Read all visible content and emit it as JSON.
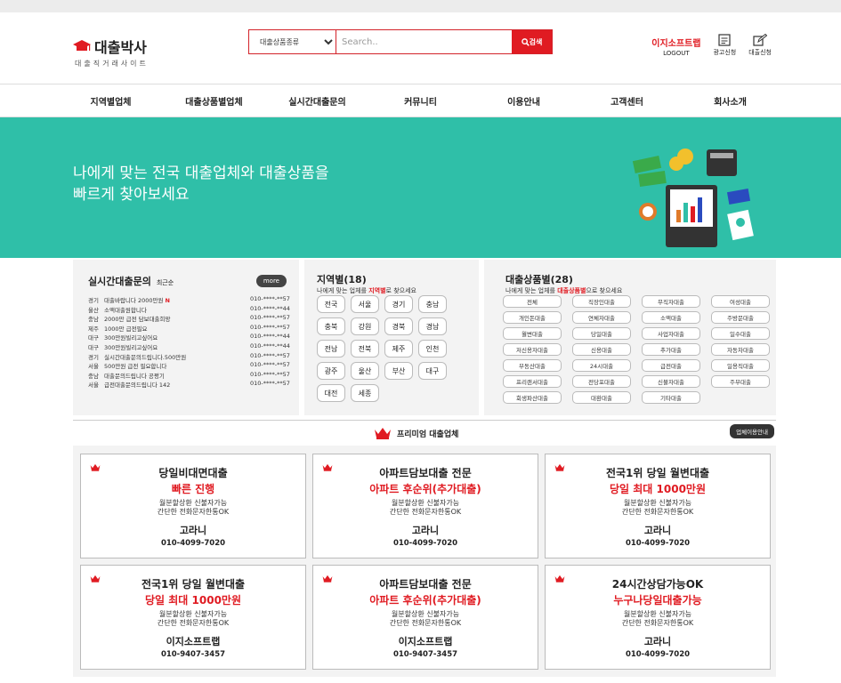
{
  "header": {
    "logo_title": "대출박사",
    "logo_sub": "대출직거래사이트",
    "search_category": "대출상품종류",
    "search_placeholder": "Search..",
    "search_button": "검색",
    "brand_link": "이지소프트랩",
    "logout": "LOGOUT",
    "ad_apply": "광고신청",
    "loan_apply": "대출신청"
  },
  "nav": [
    "지역별업체",
    "대출상품별업체",
    "실시간대출문의",
    "커뮤니티",
    "이용안내",
    "고객센터",
    "회사소개"
  ],
  "banner": {
    "line1": "나에게 맞는 전국 대출업체와 대출상품을",
    "line2": "빠르게 찾아보세요"
  },
  "realtime": {
    "title": "실시간대출문의",
    "sort": "최근순",
    "more": "more",
    "rows": [
      {
        "region": "경기",
        "text": "대출바랍니다 2000만원",
        "new": "N",
        "phone": "010-****-**57"
      },
      {
        "region": "울산",
        "text": "소액대출원합니다",
        "new": "",
        "phone": "010-****-**44"
      },
      {
        "region": "충남",
        "text": "2000만 급전 담보대출희망",
        "new": "",
        "phone": "010-****-**57"
      },
      {
        "region": "제주",
        "text": "1000만 급전필요",
        "new": "",
        "phone": "010-****-**57"
      },
      {
        "region": "대구",
        "text": "300만원빌리고싶어요",
        "new": "",
        "phone": "010-****-**44"
      },
      {
        "region": "대구",
        "text": "300만원빌리고싶어요",
        "new": "",
        "phone": "010-****-**44"
      },
      {
        "region": "경기",
        "text": "실시간대출문의드립니다.500만원",
        "new": "",
        "phone": "010-****-**57"
      },
      {
        "region": "서울",
        "text": "500만원 급전 필요합니다",
        "new": "",
        "phone": "010-****-**57"
      },
      {
        "region": "충남",
        "text": "대출문의드립니다 공평기",
        "new": "",
        "phone": "010-****-**57"
      },
      {
        "region": "서울",
        "text": "급전대출문의드립니다 142",
        "new": "",
        "phone": "010-****-**57"
      }
    ]
  },
  "regions": {
    "title": "지역별(18)",
    "sub_pre": "나에게 맞는 업체를 ",
    "sub_red": "지역별",
    "sub_post": "로 찾으세요",
    "items": [
      "전국",
      "서울",
      "경기",
      "충남",
      "충북",
      "강원",
      "경북",
      "경남",
      "전남",
      "전북",
      "제주",
      "인천",
      "광주",
      "울산",
      "부산",
      "대구",
      "대전",
      "세종"
    ]
  },
  "products": {
    "title": "대출상품별(28)",
    "sub_pre": "나에게 맞는 업체를 ",
    "sub_red": "대출상품별",
    "sub_post": "으로 찾으세요",
    "items": [
      "전체",
      "직장인대출",
      "무직자대출",
      "여성대출",
      "개인돈대출",
      "연체자대출",
      "소액대출",
      "주방문대출",
      "월변대출",
      "당일대출",
      "사업자대출",
      "일수대출",
      "저신용자대출",
      "신용대출",
      "추가대출",
      "자동차대출",
      "부동산대출",
      "24시대출",
      "급전대출",
      "일용직대출",
      "프리랜서대출",
      "전당포대출",
      "신불자대출",
      "주부대출",
      "회생파산대출",
      "대환대출",
      "기타대출"
    ]
  },
  "premium": {
    "title": "프리미엄 대출업체",
    "button": "업체이용안내",
    "cards": [
      {
        "title": "당일비대면대출",
        "highlight": "빠른 진행",
        "desc1": "월분할상환 신불자가능",
        "desc2": "간단한 전화문자한통OK",
        "company": "고라니",
        "phone": "010-4099-7020"
      },
      {
        "title": "아파트담보대출 전문",
        "highlight": "아파트 후순위(추가대출)",
        "desc1": "월분할상환 신불자가능",
        "desc2": "간단한 전화문자한통OK",
        "company": "고라니",
        "phone": "010-4099-7020"
      },
      {
        "title": "전국1위 당일 월변대출",
        "highlight": "당일 최대 1000만원",
        "desc1": "월분할상환 신불자가능",
        "desc2": "간단한 전화문자한통OK",
        "company": "고라니",
        "phone": "010-4099-7020"
      },
      {
        "title": "전국1위 당일 월변대출",
        "highlight": "당일 최대 1000만원",
        "desc1": "월분할상환 신불자가능",
        "desc2": "간단한 전화문자한통OK",
        "company": "이지소프트랩",
        "phone": "010-9407-3457"
      },
      {
        "title": "아파트담보대출 전문",
        "highlight": "아파트 후순위(추가대출)",
        "desc1": "월분할상환 신불자가능",
        "desc2": "간단한 전화문자한통OK",
        "company": "이지소프트랩",
        "phone": "010-9407-3457"
      },
      {
        "title": "24시간상담가능OK",
        "highlight": "누구나당일대출가능",
        "desc1": "월분할상환 신불자가능",
        "desc2": "간단한 전화문자한통OK",
        "company": "고라니",
        "phone": "010-4099-7020"
      }
    ]
  },
  "colors": {
    "accent": "#e01b22",
    "banner": "#2fbfa8"
  }
}
